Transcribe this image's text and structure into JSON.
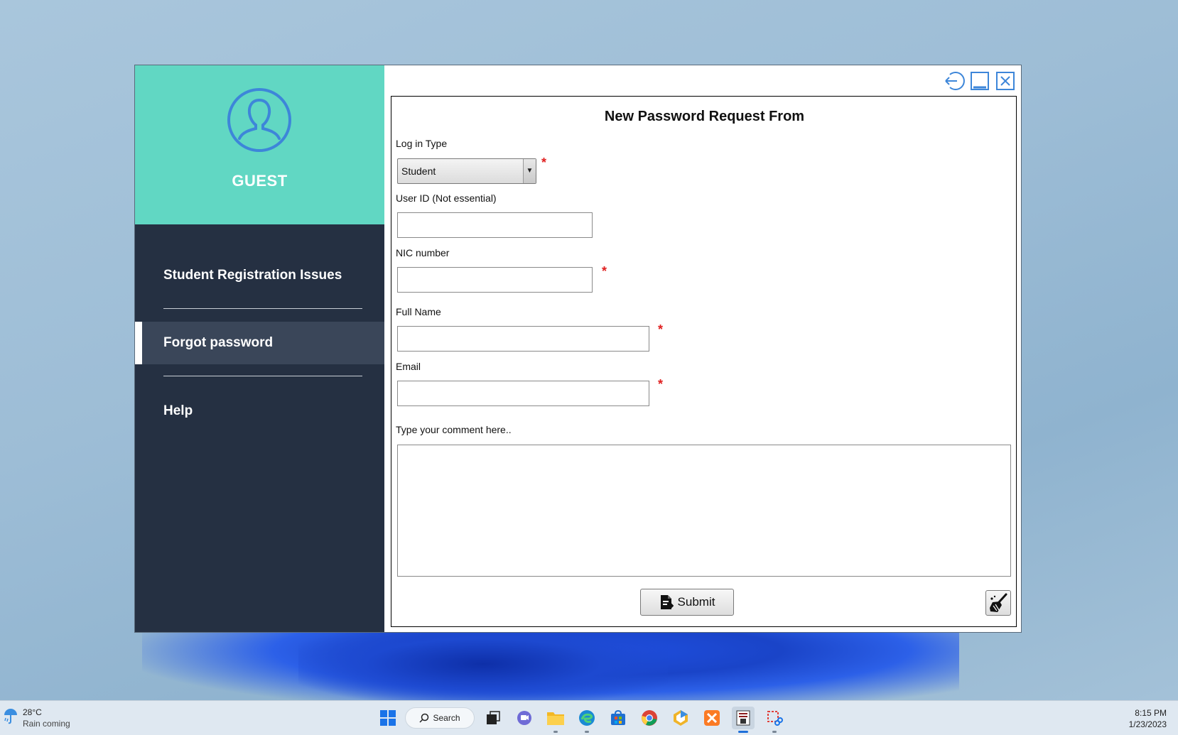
{
  "sidebar": {
    "user_label": "GUEST",
    "items": [
      {
        "label": "Student Registration Issues"
      },
      {
        "label": "Forgot password"
      },
      {
        "label": "Help"
      }
    ]
  },
  "form": {
    "title": "New Password Request From",
    "login_type_label": "Log in Type",
    "login_type_value": "Student",
    "user_id_label": "User ID (Not essential)",
    "nic_label": "NIC number",
    "full_name_label": "Full Name",
    "email_label": "Email",
    "comment_label": "Type your comment here..",
    "required_mark": "*",
    "submit_label": "Submit"
  },
  "taskbar": {
    "weather_temp": "28°C",
    "weather_desc": "Rain coming",
    "search_label": "Search",
    "time": "8:15 PM",
    "date": "1/23/2023"
  },
  "colors": {
    "sidebar_header": "#61d7c3",
    "sidebar_bg": "#253042",
    "active_item": "#3a4659",
    "accent_blue": "#3d86d9",
    "required": "#e02020"
  }
}
